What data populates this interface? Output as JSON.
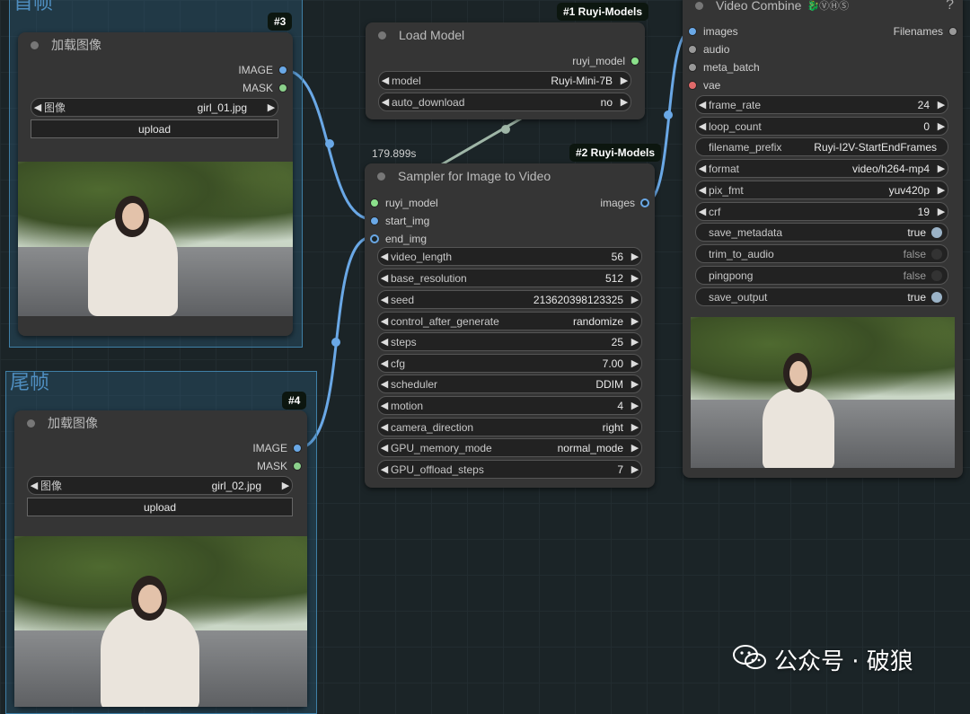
{
  "groups": {
    "first_frame": {
      "title": "首帧"
    },
    "last_frame": {
      "title": "尾帧"
    }
  },
  "node3": {
    "badge": "#3",
    "title": "加载图像",
    "outputs": [
      "IMAGE",
      "MASK"
    ],
    "image_widget": {
      "label": "图像",
      "value": "girl_01.jpg"
    },
    "upload": "upload"
  },
  "node4": {
    "badge": "#4",
    "title": "加载图像",
    "outputs": [
      "IMAGE",
      "MASK"
    ],
    "image_widget": {
      "label": "图像",
      "value": "girl_02.jpg"
    },
    "upload": "upload"
  },
  "load_model": {
    "badge": "#1 Ruyi-Models",
    "title": "Load Model",
    "output": "ruyi_model",
    "widgets": [
      {
        "label": "model",
        "value": "Ruyi-Mini-7B"
      },
      {
        "label": "auto_download",
        "value": "no"
      }
    ]
  },
  "sampler": {
    "badge": "#2 Ruyi-Models",
    "time": "179.899s",
    "title": "Sampler for Image to Video",
    "inputs": [
      "ruyi_model",
      "start_img",
      "end_img"
    ],
    "output": "images",
    "widgets": [
      {
        "label": "video_length",
        "value": "56"
      },
      {
        "label": "base_resolution",
        "value": "512"
      },
      {
        "label": "seed",
        "value": "213620398123325"
      },
      {
        "label": "control_after_generate",
        "value": "randomize"
      },
      {
        "label": "steps",
        "value": "25"
      },
      {
        "label": "cfg",
        "value": "7.00"
      },
      {
        "label": "scheduler",
        "value": "DDIM"
      },
      {
        "label": "motion",
        "value": "4"
      },
      {
        "label": "camera_direction",
        "value": "right"
      },
      {
        "label": "GPU_memory_mode",
        "value": "normal_mode"
      },
      {
        "label": "GPU_offload_steps",
        "value": "7"
      }
    ]
  },
  "video_combine": {
    "title": "Video Combine",
    "title_tags": "🐉ⓋⒽⓈ",
    "help": "?",
    "inputs": [
      "images",
      "audio",
      "meta_batch",
      "vae"
    ],
    "output": "Filenames",
    "widgets": [
      {
        "label": "frame_rate",
        "value": "24",
        "type": "number"
      },
      {
        "label": "loop_count",
        "value": "0",
        "type": "number"
      },
      {
        "label": "filename_prefix",
        "value": "Ruyi-I2V-StartEndFrames",
        "type": "text"
      },
      {
        "label": "format",
        "value": "video/h264-mp4",
        "type": "combo"
      },
      {
        "label": "pix_fmt",
        "value": "yuv420p",
        "type": "combo"
      },
      {
        "label": "crf",
        "value": "19",
        "type": "number"
      },
      {
        "label": "save_metadata",
        "value": "true",
        "type": "toggle"
      },
      {
        "label": "trim_to_audio",
        "value": "false",
        "type": "toggle"
      },
      {
        "label": "pingpong",
        "value": "false",
        "type": "toggle"
      },
      {
        "label": "save_output",
        "value": "true",
        "type": "toggle"
      }
    ]
  },
  "watermark": "公众号 · 破狼",
  "colors": {
    "image_socket": "#6aa8e6",
    "mask_socket": "#8bd08b",
    "model_socket": "#8be08b",
    "vae_socket": "#e06a6a",
    "link_image": "#6aa8e6",
    "link_model": "#9fb6a7"
  }
}
